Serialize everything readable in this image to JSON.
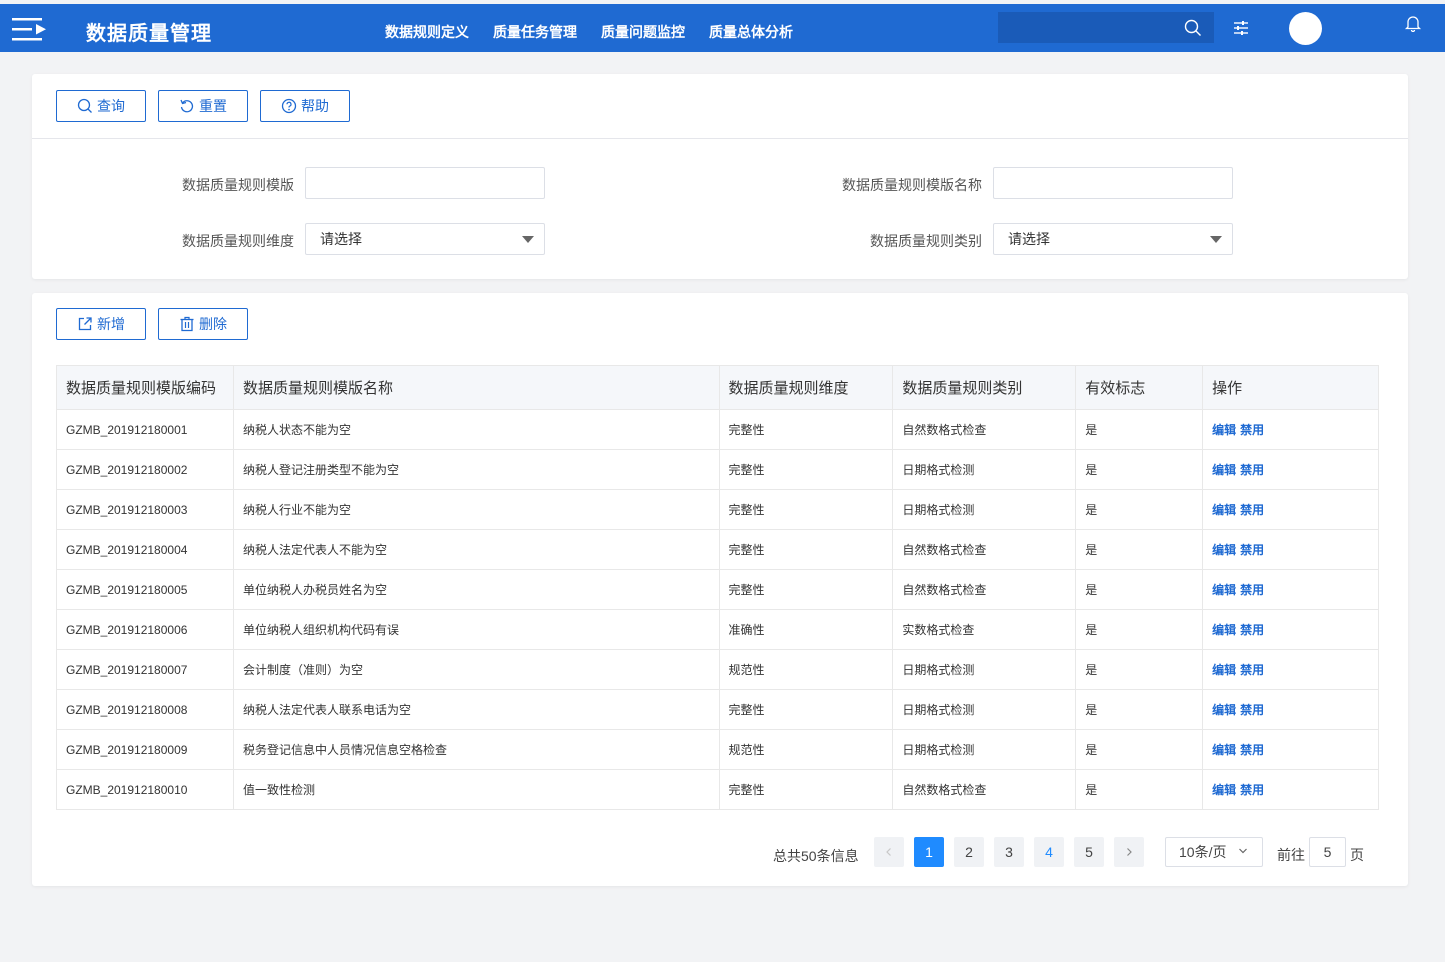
{
  "app": {
    "title": "数据质量管理"
  },
  "nav": [
    "数据规则定义",
    "质量任务管理",
    "质量问题监控",
    "质量总体分析"
  ],
  "header": {
    "search_value": ""
  },
  "query": {
    "buttons": {
      "search": "查询",
      "reset": "重置",
      "help": "帮助"
    },
    "fields": {
      "template_label": "数据质量规则模版",
      "template_value": "",
      "template_name_label": "数据质量规则模版名称",
      "template_name_value": "",
      "dimension_label": "数据质量规则维度",
      "dimension_value": "请选择",
      "category_label": "数据质量规则类别",
      "category_value": "请选择"
    }
  },
  "actions": {
    "add": "新增",
    "delete": "删除"
  },
  "table": {
    "headers": [
      "数据质量规则模版编码",
      "数据质量规则模版名称",
      "数据质量规则维度",
      "数据质量规则类别",
      "有效标志",
      "操作"
    ],
    "op_edit": "编辑",
    "op_disable": "禁用",
    "rows": [
      [
        "GZMB_201912180001",
        "纳税人状态不能为空",
        "完整性",
        "自然数格式检查",
        "是"
      ],
      [
        "GZMB_201912180002",
        "纳税人登记注册类型不能为空",
        "完整性",
        "日期格式检测",
        "是"
      ],
      [
        "GZMB_201912180003",
        "纳税人行业不能为空",
        "完整性",
        "日期格式检测",
        "是"
      ],
      [
        "GZMB_201912180004",
        "纳税人法定代表人不能为空",
        "完整性",
        "自然数格式检查",
        "是"
      ],
      [
        "GZMB_201912180005",
        "单位纳税人办税员姓名为空",
        "完整性",
        "自然数格式检查",
        "是"
      ],
      [
        "GZMB_201912180006",
        "单位纳税人组织机构代码有误",
        "准确性",
        "实数格式检查",
        "是"
      ],
      [
        "GZMB_201912180007",
        "会计制度（准则）为空",
        "规范性",
        "日期格式检测",
        "是"
      ],
      [
        "GZMB_201912180008",
        "纳税人法定代表人联系电话为空",
        "完整性",
        "日期格式检测",
        "是"
      ],
      [
        "GZMB_201912180009",
        "税务登记信息中人员情况信息空格检查",
        "规范性",
        "日期格式检测",
        "是"
      ],
      [
        "GZMB_201912180010",
        "值一致性检测",
        "完整性",
        "自然数格式检查",
        "是"
      ]
    ]
  },
  "pagination": {
    "total": "总共50条信息",
    "pages": [
      "1",
      "2",
      "3",
      "4",
      "5"
    ],
    "current": "1",
    "page_size": "10条/页",
    "goto_label": "前往",
    "goto_value": "5",
    "goto_suffix": "页"
  },
  "colors": {
    "primary": "#1f6ad2",
    "active_page": "#1f8bff"
  }
}
